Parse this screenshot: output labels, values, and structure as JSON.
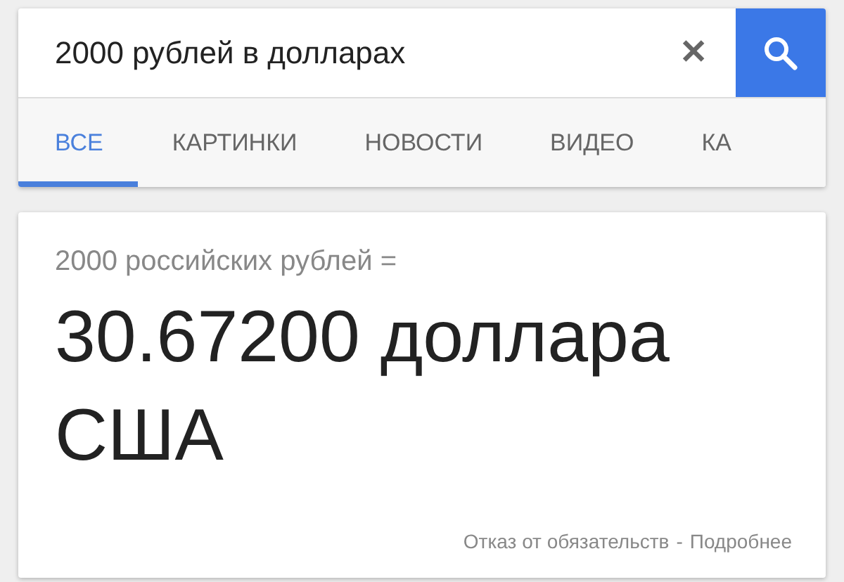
{
  "search": {
    "value": "2000 рублей в долларах",
    "clear_icon": "✕"
  },
  "tabs": [
    {
      "label": "ВСЕ",
      "selected": true
    },
    {
      "label": "КАРТИНКИ",
      "selected": false
    },
    {
      "label": "НОВОСТИ",
      "selected": false
    },
    {
      "label": "ВИДЕО",
      "selected": false
    },
    {
      "label": "КА",
      "selected": false
    }
  ],
  "result": {
    "from": "2000 российских рублей =",
    "to": "30.67200 доллара США",
    "disclaimer": "Отказ от обязательств",
    "separator": "-",
    "more": "Подробнее"
  }
}
